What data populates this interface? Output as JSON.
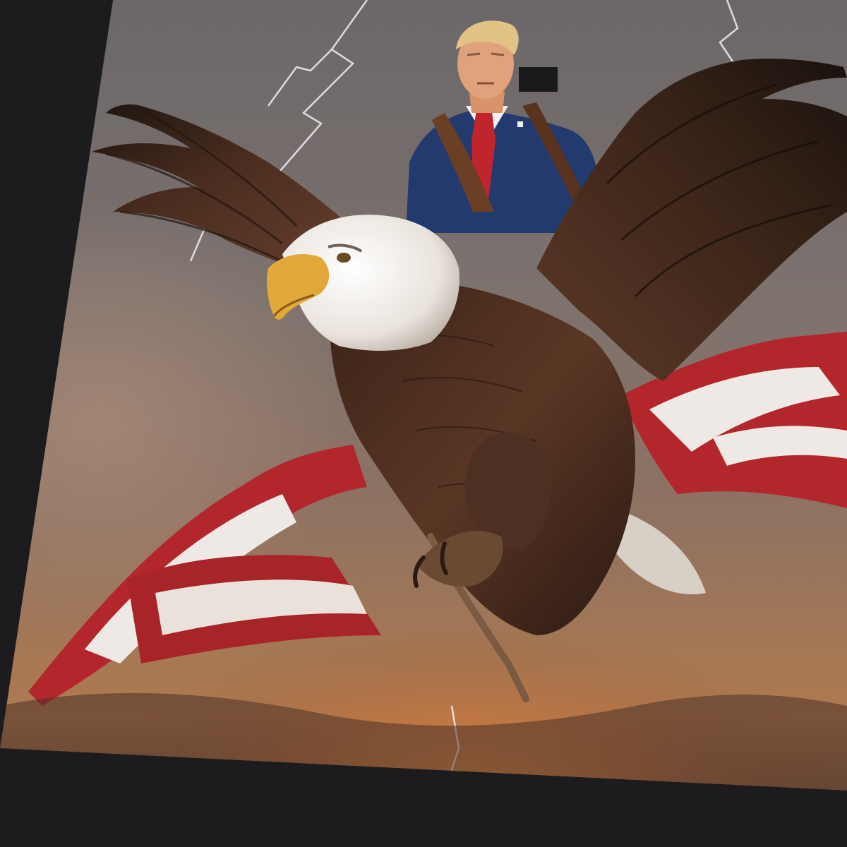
{
  "scene": {
    "subject": "printed-tshirt-graphic",
    "colors": {
      "fabric": "#1c1c1e",
      "sky_storm": "#6e6a6c",
      "sky_warm": "#b07a4e",
      "sunset_glow": "#e8893a",
      "flag_red": "#b3262c",
      "flag_white": "#eee9e4",
      "eagle_body": "#4a2e1e",
      "eagle_feather": "#7a4a2e",
      "eagle_head": "#f2efe9",
      "beak": "#e2a93a",
      "suit_blue": "#233a6e",
      "tie_red": "#c0242c",
      "skin": "#e0a27c",
      "hair": "#e3c287",
      "lightning": "#f1eef6"
    }
  }
}
